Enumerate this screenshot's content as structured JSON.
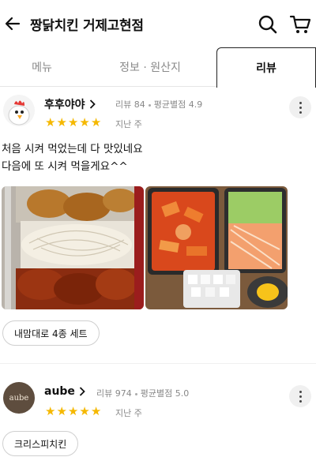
{
  "header": {
    "title": "짱닭치킨 거제고현점",
    "back_icon": "arrow-left-icon",
    "search_icon": "search-icon",
    "cart_icon": "cart-icon"
  },
  "tabs": [
    {
      "label": "메뉴",
      "active": false
    },
    {
      "label": "정보 · 원산지",
      "active": false
    },
    {
      "label": "리뷰",
      "active": true
    }
  ],
  "colors": {
    "star": "#f5b800",
    "accent": "#111111",
    "muted": "#888888"
  },
  "reviews": [
    {
      "nickname": "후후야야",
      "review_count": "리뷰 84",
      "avg_rating": "평균별점 4.9",
      "rating": 5,
      "date": "지난 주",
      "text": "처음 시켜 먹었는데 다 맛있네요\n다음에 또 시켜 먹을게요^^",
      "menu_chip": "내맘대로 4종 세트"
    },
    {
      "nickname": "aube",
      "avatar_text": "aube",
      "review_count": "리뷰 974",
      "avg_rating": "평균별점 5.0",
      "rating": 5,
      "date": "지난 주",
      "menu_chip": "크리스피치킨"
    }
  ]
}
